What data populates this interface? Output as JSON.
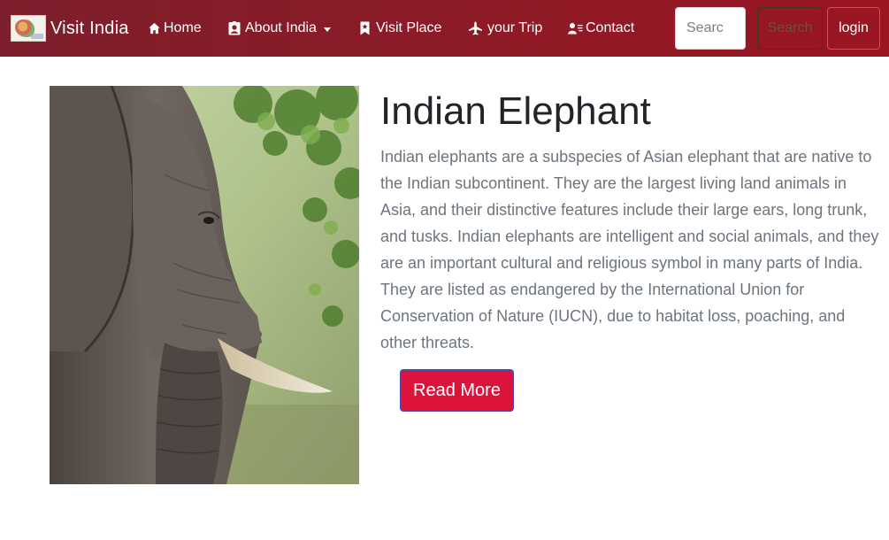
{
  "navbar": {
    "brand": "Visit India",
    "items": [
      {
        "label": "Home",
        "icon": "house-icon"
      },
      {
        "label": "About India",
        "icon": "person-badge-icon",
        "dropdown": true
      },
      {
        "label": "Visit Place",
        "icon": "bookmark-icon"
      },
      {
        "label": "your Trip",
        "icon": "airplane-icon"
      },
      {
        "label": "Contact",
        "icon": "person-lines-icon"
      }
    ],
    "search_placeholder": "Searc",
    "search_button": "Search",
    "login_button": "login"
  },
  "article": {
    "title": "Indian Elephant",
    "description": "Indian elephants are a subspecies of Asian elephant that are native to the Indian subcontinent. They are the largest living land animals in Asia, and their distinctive features include their large ears, long trunk, and tusks. Indian elephants are intelligent and social animals, and they are an important cultural and religious symbol in many parts of India. They are listed as endangered by the International Union for Conservation of Nature (IUCN), due to habitat loss, poaching, and other threats.",
    "read_more": "Read More"
  },
  "colors": {
    "navbar_start": "#7d1f2c",
    "navbar_end": "#9a1522",
    "read_more_bg": "#dc143c",
    "text_muted": "#6c757d"
  }
}
